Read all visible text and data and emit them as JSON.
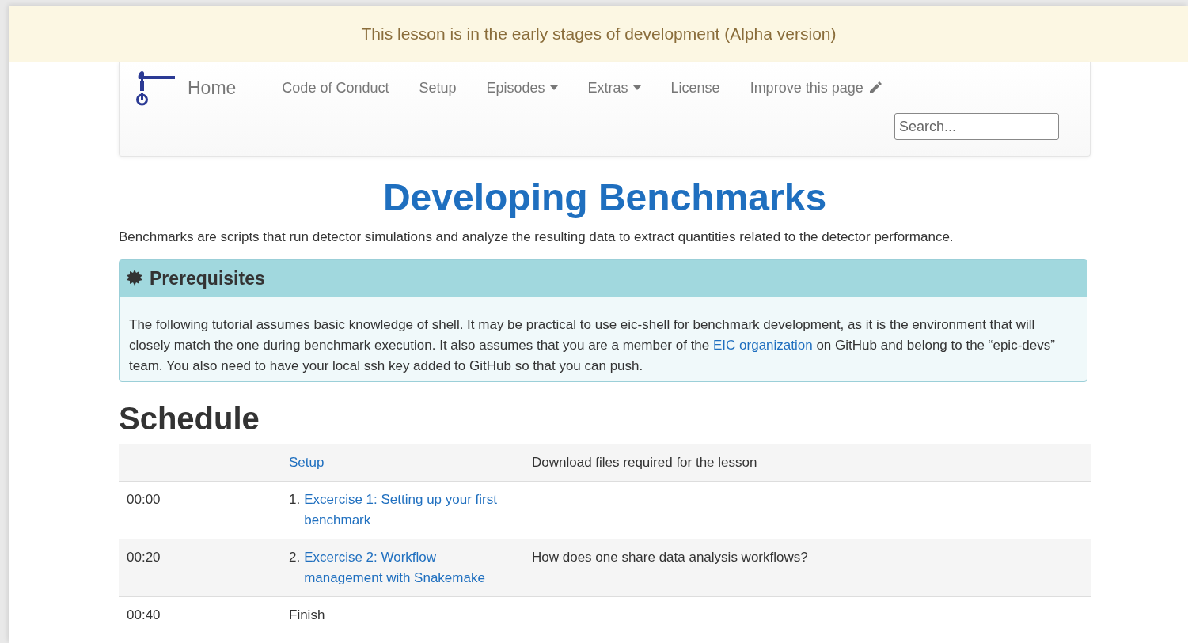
{
  "banner": {
    "text": "This lesson is in the early stages of development (Alpha version)"
  },
  "navbar": {
    "brand": "Home",
    "items": [
      {
        "label": "Code of Conduct",
        "kind": "link"
      },
      {
        "label": "Setup",
        "kind": "link"
      },
      {
        "label": "Episodes",
        "kind": "dropdown"
      },
      {
        "label": "Extras",
        "kind": "dropdown"
      },
      {
        "label": "License",
        "kind": "link"
      },
      {
        "label": "Improve this page",
        "kind": "edit"
      }
    ],
    "search": {
      "placeholder": "Search..."
    }
  },
  "title": "Developing Benchmarks",
  "intro": "Benchmarks are scripts that run detector simulations and analyze the resulting data to extract quantities related to the detector performance.",
  "prerequisites": {
    "title": "Prerequisites",
    "text_before": "The following tutorial assumes basic knowledge of shell. It may be practical to use eic-shell for benchmark development, as it is the environment that will closely match the one during benchmark execution. It also assumes that you are a member of the ",
    "link": "EIC organization",
    "text_after": " on GitHub and belong to the “epic-devs” team. You also need to have your local ssh key added to GitHub so that you can push."
  },
  "schedule": {
    "title": "Schedule",
    "rows": [
      {
        "time": "",
        "number": "",
        "episode": "Setup",
        "kind": "link",
        "question": "Download files required for the lesson"
      },
      {
        "time": "00:00",
        "number": "1.",
        "episode": "Excercise 1: Setting up your first benchmark",
        "kind": "link",
        "question": ""
      },
      {
        "time": "00:20",
        "number": "2.",
        "episode": "Excercise 2: Workflow management with Snakemake",
        "kind": "link",
        "question": "How does one share data analysis workflows?"
      },
      {
        "time": "00:40",
        "number": "",
        "episode": "Finish",
        "kind": "text",
        "question": ""
      }
    ]
  }
}
